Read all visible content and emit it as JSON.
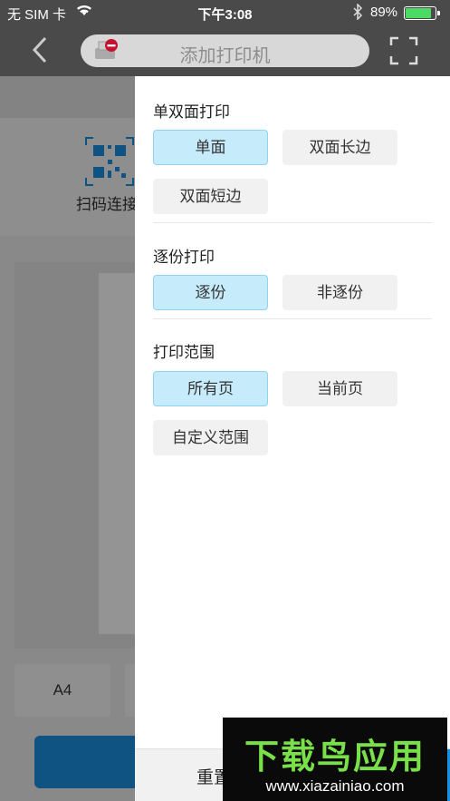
{
  "status_bar": {
    "carrier": "无 SIM 卡",
    "time": "下午3:08",
    "battery_pct": "89%",
    "battery_level": 0.89,
    "battery_color": "#4cd964"
  },
  "nav": {
    "back_icon": "chevron-left-icon",
    "search_placeholder": "添加打印机",
    "printer_icon": "printer-disconnected-icon",
    "scan_icon": "scan-frame-icon"
  },
  "background": {
    "scan_label": "扫码连接",
    "paper_size": "A4",
    "reset_label": "重置"
  },
  "panel": {
    "duplex": {
      "title": "单双面打印",
      "options": [
        "单面",
        "双面长边",
        "双面短边"
      ],
      "selected": "单面"
    },
    "collate": {
      "title": "逐份打印",
      "options": [
        "逐份",
        "非逐份"
      ],
      "selected": "逐份"
    },
    "range": {
      "title": "打印范围",
      "options": [
        "所有页",
        "当前页",
        "自定义范围"
      ],
      "selected": "所有页"
    }
  },
  "colors": {
    "accent": "#1a8fe0",
    "selected_bg": "#c6ebfb",
    "selected_border": "#8fd3f3"
  },
  "watermark": {
    "title": "下载鸟应用",
    "url": "www.xiazainiao.com"
  }
}
